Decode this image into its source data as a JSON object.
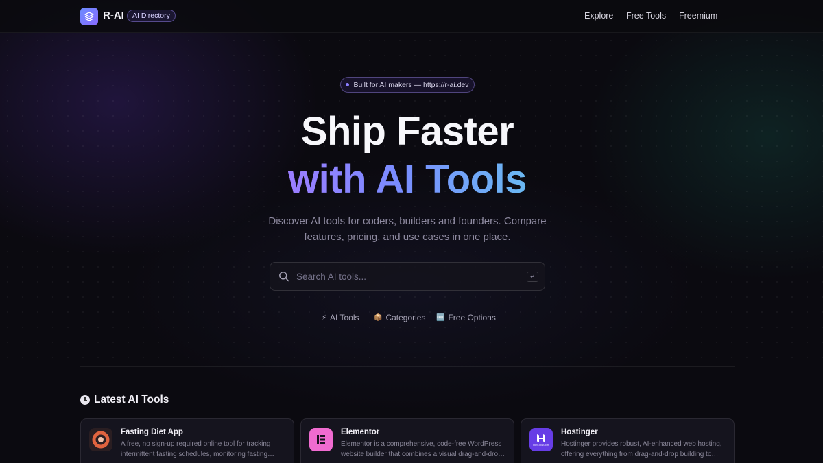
{
  "header": {
    "brand": "R-AI",
    "badge": "AI Directory",
    "nav": [
      "Explore",
      "Free Tools",
      "Freemium"
    ]
  },
  "hero": {
    "pill": "Built for AI makers — https://r-ai.dev",
    "title_line1": "Ship Faster",
    "title_line2": "with AI Tools",
    "subtitle": "Discover AI tools for coders, builders and founders. Compare features, pricing, and use cases in one place.",
    "search_placeholder": "Search AI tools...",
    "search_shortcut": "↵",
    "quick_links": [
      {
        "icon": "⚡",
        "label": "AI Tools"
      },
      {
        "icon": "📦",
        "label": "Categories"
      },
      {
        "icon": "🆓",
        "label": "Free Options"
      }
    ]
  },
  "latest": {
    "title": "Latest AI Tools",
    "cards": [
      {
        "name": "Fasting Diet App",
        "description": "A free, no sign-up required online tool for tracking intermittent fasting schedules, monitoring fasting progress and more.",
        "logo_color": "#e0633f"
      },
      {
        "name": "Elementor",
        "description": "Elementor is a comprehensive, code-free WordPress website builder that combines a visual drag-and-drop editor with AI.",
        "logo_color": "#f06bd0"
      },
      {
        "name": "Hostinger",
        "description": "Hostinger provides robust, AI-enhanced web hosting, offering everything from drag-and-drop building to domains.",
        "logo_color": "#673de6",
        "logo_text": "HOSTINGER"
      }
    ]
  },
  "colors": {
    "background": "#0b0a10",
    "accent": "#8a7dff",
    "gradient_start": "#9b7dff",
    "gradient_end": "#6ab8f2"
  }
}
